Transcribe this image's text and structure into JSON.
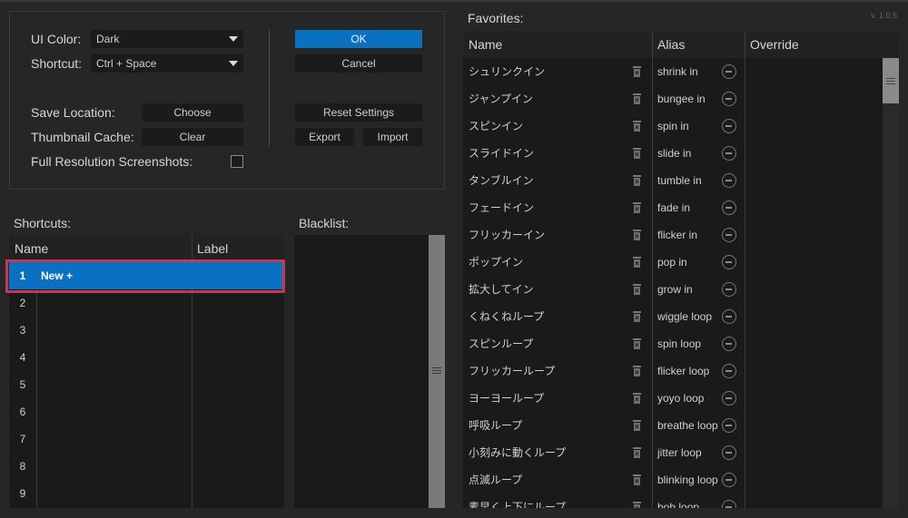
{
  "version": "v. 1.0.5",
  "settings": {
    "ui_color_label": "UI Color:",
    "ui_color_value": "Dark",
    "shortcut_label": "Shortcut:",
    "shortcut_value": "Ctrl + Space",
    "save_location_label": "Save Location:",
    "choose_label": "Choose",
    "thumbnail_cache_label": "Thumbnail Cache:",
    "clear_label": "Clear",
    "full_res_label": "Full Resolution Screenshots:",
    "full_res_checked": false,
    "ok_label": "OK",
    "cancel_label": "Cancel",
    "reset_label": "Reset Settings",
    "export_label": "Export",
    "import_label": "Import"
  },
  "shortcuts": {
    "title": "Shortcuts:",
    "columns": [
      "Name",
      "Label"
    ],
    "rows": [
      {
        "index": "1",
        "name": "New +",
        "label": "",
        "selected": true
      },
      {
        "index": "2",
        "name": "",
        "label": ""
      },
      {
        "index": "3",
        "name": "",
        "label": ""
      },
      {
        "index": "4",
        "name": "",
        "label": ""
      },
      {
        "index": "5",
        "name": "",
        "label": ""
      },
      {
        "index": "6",
        "name": "",
        "label": ""
      },
      {
        "index": "7",
        "name": "",
        "label": ""
      },
      {
        "index": "8",
        "name": "",
        "label": ""
      },
      {
        "index": "9",
        "name": "",
        "label": ""
      }
    ]
  },
  "blacklist": {
    "title": "Blacklist:"
  },
  "favorites": {
    "title": "Favorites:",
    "columns": [
      "Name",
      "Alias",
      "Override"
    ],
    "rows": [
      {
        "name": "シュリンクイン",
        "alias": "shrink in"
      },
      {
        "name": "ジャンプイン",
        "alias": "bungee in"
      },
      {
        "name": "スピンイン",
        "alias": "spin in"
      },
      {
        "name": "スライドイン",
        "alias": "slide in"
      },
      {
        "name": "タンブルイン",
        "alias": "tumble in"
      },
      {
        "name": "フェードイン",
        "alias": "fade in"
      },
      {
        "name": "フリッカーイン",
        "alias": "flicker in"
      },
      {
        "name": "ポップイン",
        "alias": "pop in"
      },
      {
        "name": "拡大してイン",
        "alias": "grow in"
      },
      {
        "name": "くねくねループ",
        "alias": "wiggle loop"
      },
      {
        "name": "スピンループ",
        "alias": "spin loop"
      },
      {
        "name": "フリッカーループ",
        "alias": "flicker loop"
      },
      {
        "name": "ヨーヨーループ",
        "alias": "yoyo loop"
      },
      {
        "name": "呼吸ループ",
        "alias": "breathe loop"
      },
      {
        "name": "小刻みに動くループ",
        "alias": "jitter loop"
      },
      {
        "name": "点滅ループ",
        "alias": "blinking loop"
      },
      {
        "name": "素早く上下にループ",
        "alias": "bob loop"
      }
    ]
  },
  "colors": {
    "accent": "#0a70c0",
    "highlight": "#c03a55",
    "background": "#262626"
  }
}
